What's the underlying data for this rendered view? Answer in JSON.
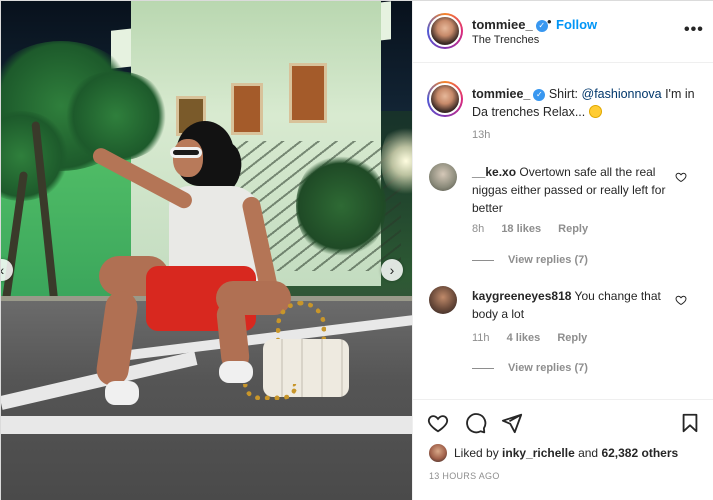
{
  "post": {
    "author": "tommiee_",
    "follow_label": "Follow",
    "separator": "•",
    "location": "The Trenches",
    "more_icon": "more-horizontal-icon"
  },
  "caption": {
    "author": "tommiee_",
    "text_prefix": "Shirt: ",
    "mention": "@fashionnova",
    "text_suffix": " I'm in Da trenches Relax...",
    "time": "13h"
  },
  "comments": [
    {
      "username": "__ke.xo",
      "text": "Overtown safe all the real niggas either passed or really left for better",
      "time": "8h",
      "likes": "18 likes",
      "reply_label": "Reply",
      "view_replies": "View replies (7)"
    },
    {
      "username": "kaygreeneyes818",
      "text": "You change that body a lot",
      "time": "11h",
      "likes": "4 likes",
      "reply_label": "Reply",
      "view_replies": "View replies (7)"
    }
  ],
  "likes": {
    "prefix": "Liked by ",
    "user": "inky_richelle",
    "middle": " and ",
    "others": "62,382 others"
  },
  "timestamp": "13 HOURS AGO",
  "colors": {
    "follow": "#0095f6",
    "verified": "#3897f0",
    "text": "#262626",
    "muted": "#8e8e8e"
  }
}
